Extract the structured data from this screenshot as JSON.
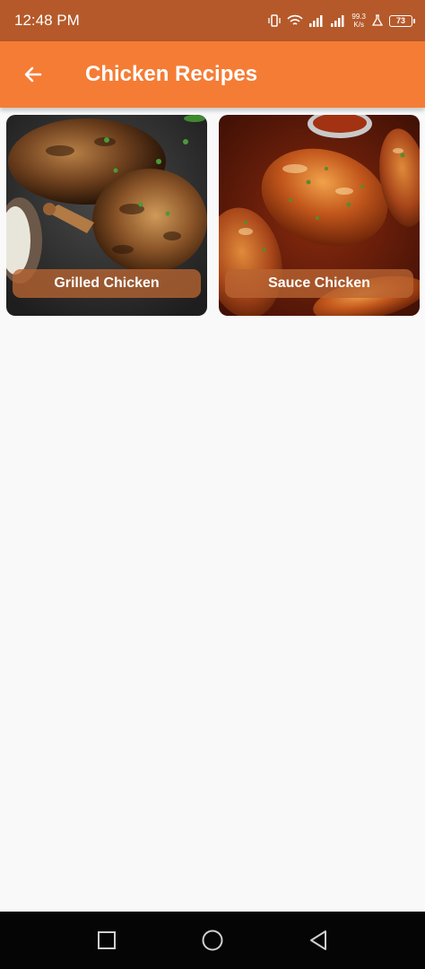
{
  "status_bar": {
    "time": "12:48 PM",
    "net_speed_value": "99.3",
    "net_speed_unit": "K/s",
    "battery_level": "73",
    "icons": [
      "vibrate-icon",
      "wifi-icon",
      "signal-icon",
      "signal-icon",
      "flask-icon",
      "battery-icon"
    ]
  },
  "app_bar": {
    "title": "Chicken Recipes",
    "back_icon": "arrow-left-icon",
    "color": "#f57c35"
  },
  "recipes": [
    {
      "label": "Grilled Chicken",
      "image": "grilled-chicken-photo"
    },
    {
      "label": "Sauce Chicken",
      "image": "sauce-chicken-photo"
    }
  ],
  "nav_bar": {
    "buttons": [
      "recents-square-icon",
      "home-circle-icon",
      "back-triangle-icon"
    ]
  }
}
